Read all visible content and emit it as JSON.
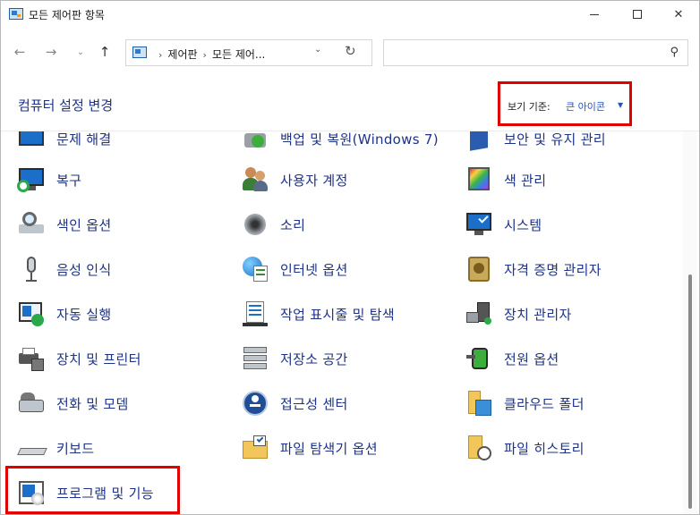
{
  "window": {
    "title": "모든 제어판 항목",
    "controls": {
      "minimize": "",
      "maximize": "",
      "close": "✕"
    }
  },
  "nav": {
    "back": "←",
    "forward": "→",
    "recent": "⌄",
    "up": "↑",
    "breadcrumbs": [
      "제어판",
      "모든 제어..."
    ],
    "separator": "›",
    "dropdown": "⌄",
    "refresh": "↻",
    "search_placeholder": "",
    "search_icon": "⚲"
  },
  "header": {
    "title": "컴퓨터 설정 변경",
    "view_by_label": "보기 기준:",
    "view_by_value": "큰 아이콘",
    "view_by_caret": "▼"
  },
  "items": [
    {
      "label": "문제 해결",
      "icon": "troubleshooting-icon"
    },
    {
      "label": "백업 및 복원(Windows 7)",
      "icon": "backup-restore-icon"
    },
    {
      "label": "보안 및 유지 관리",
      "icon": "security-maintenance-icon"
    },
    {
      "label": "복구",
      "icon": "recovery-icon"
    },
    {
      "label": "사용자 계정",
      "icon": "user-accounts-icon"
    },
    {
      "label": "색 관리",
      "icon": "color-management-icon"
    },
    {
      "label": "색인 옵션",
      "icon": "indexing-options-icon"
    },
    {
      "label": "소리",
      "icon": "sound-icon"
    },
    {
      "label": "시스템",
      "icon": "system-icon"
    },
    {
      "label": "음성 인식",
      "icon": "speech-recognition-icon"
    },
    {
      "label": "인터넷 옵션",
      "icon": "internet-options-icon"
    },
    {
      "label": "자격 증명 관리자",
      "icon": "credential-manager-icon"
    },
    {
      "label": "자동 실행",
      "icon": "autoplay-icon"
    },
    {
      "label": "작업 표시줄 및 탐색",
      "icon": "taskbar-navigation-icon"
    },
    {
      "label": "장치 관리자",
      "icon": "device-manager-icon"
    },
    {
      "label": "장치 및 프린터",
      "icon": "devices-printers-icon"
    },
    {
      "label": "저장소 공간",
      "icon": "storage-spaces-icon"
    },
    {
      "label": "전원 옵션",
      "icon": "power-options-icon"
    },
    {
      "label": "전화 및 모뎀",
      "icon": "phone-modem-icon"
    },
    {
      "label": "접근성 센터",
      "icon": "ease-of-access-icon"
    },
    {
      "label": "클라우드 폴더",
      "icon": "cloud-folder-icon"
    },
    {
      "label": "키보드",
      "icon": "keyboard-icon"
    },
    {
      "label": "파일 탐색기 옵션",
      "icon": "file-explorer-options-icon"
    },
    {
      "label": "파일 히스토리",
      "icon": "file-history-icon"
    },
    {
      "label": "프로그램 및 기능",
      "icon": "programs-features-icon"
    }
  ]
}
